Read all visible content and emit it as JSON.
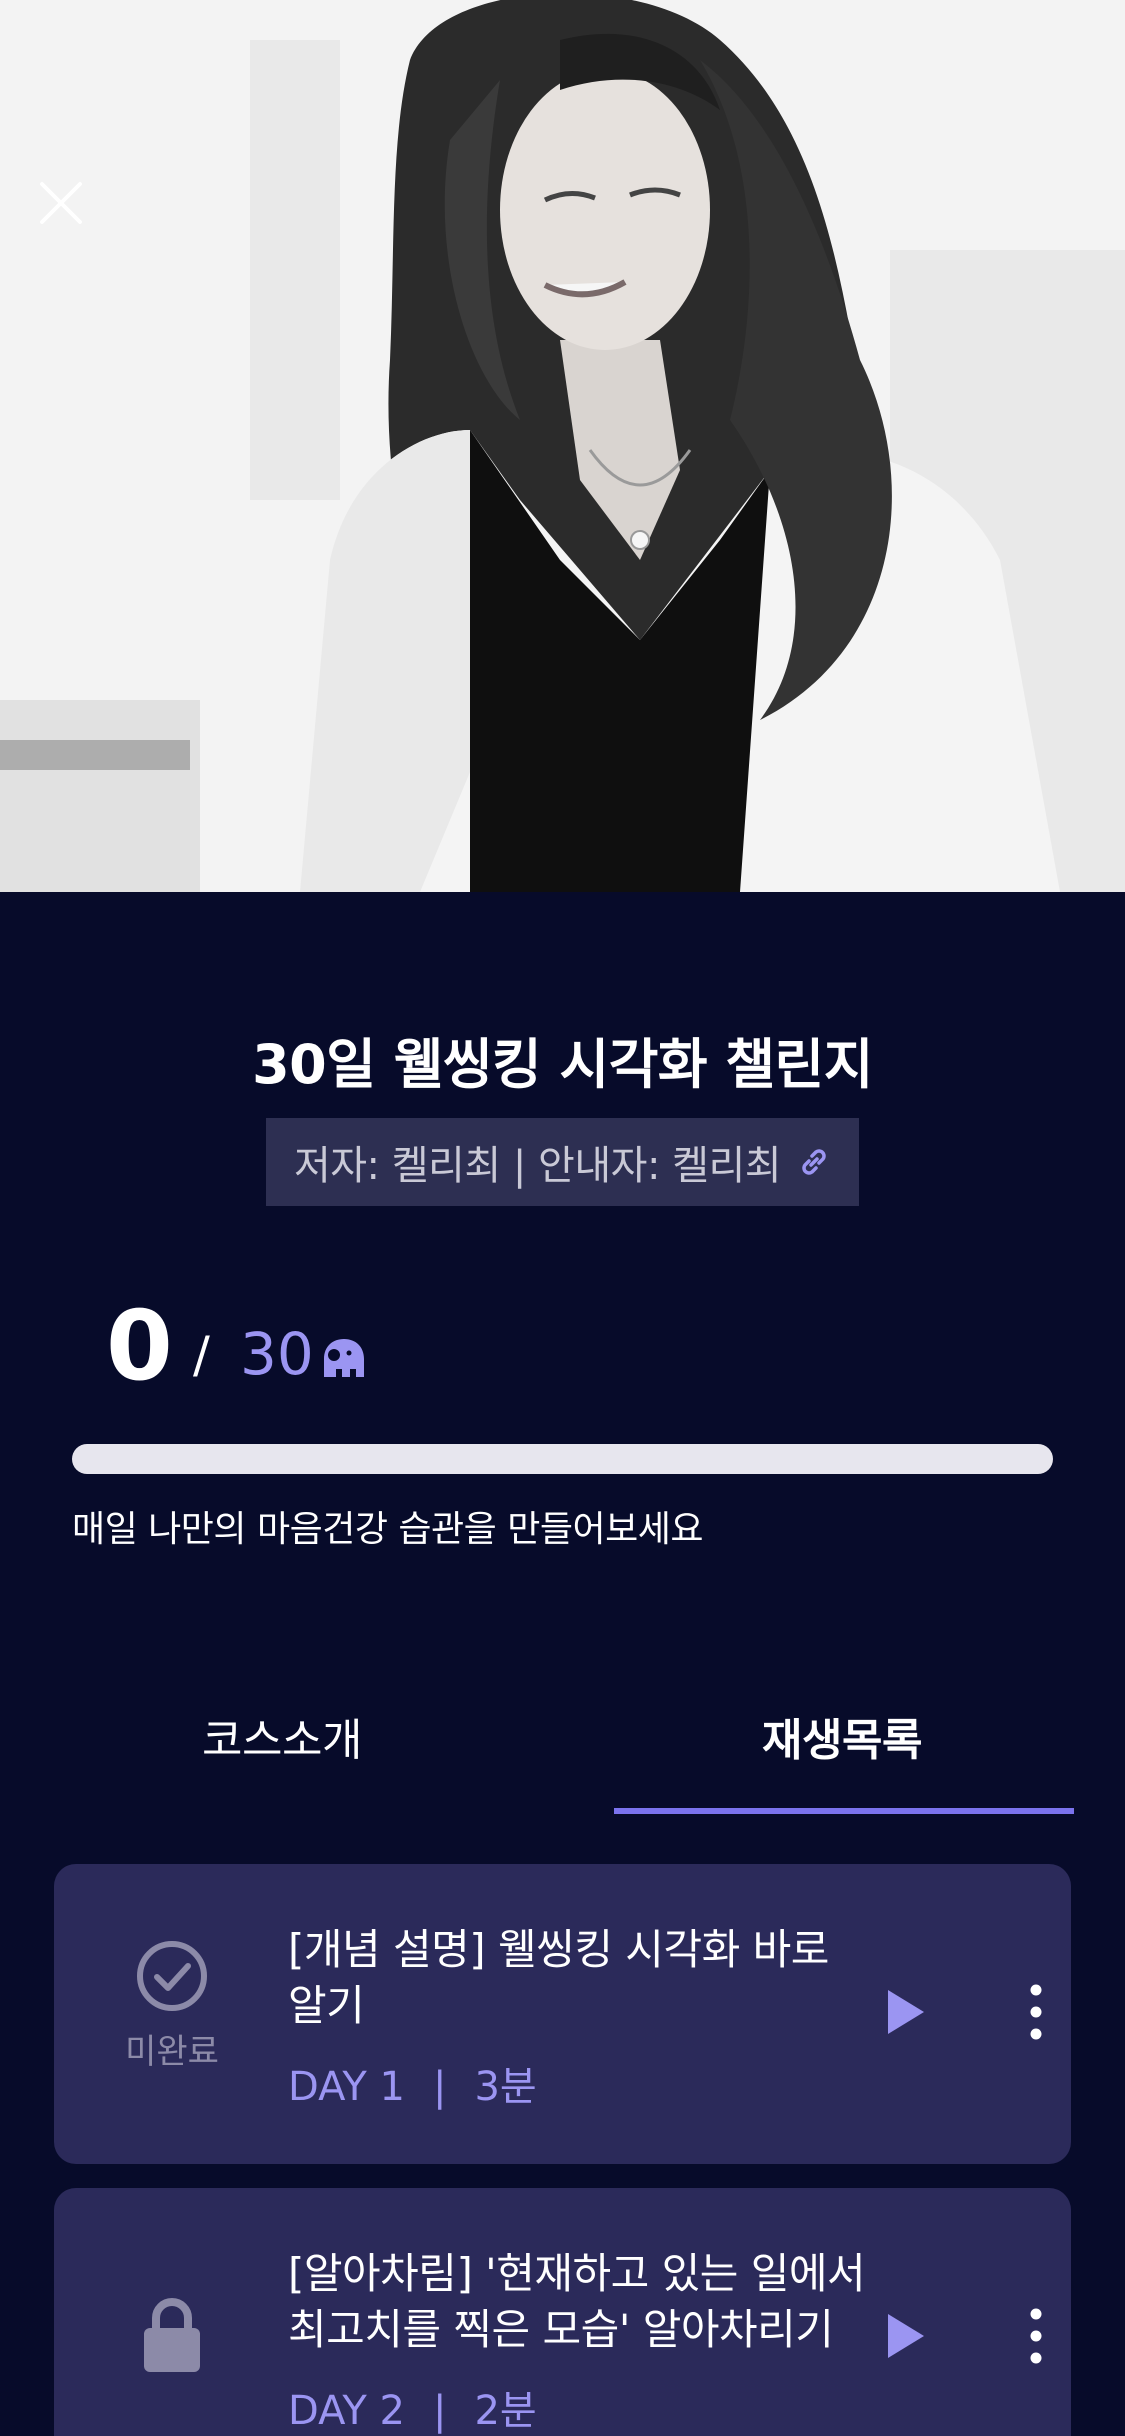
{
  "hero": {
    "image_alt": "course hero photo"
  },
  "course": {
    "title": "30일 웰씽킹 시각화 챌린지",
    "author_line": "저자: 켈리최 | 안내자: 켈리최"
  },
  "progress": {
    "completed": "0",
    "separator": "/",
    "total": "30",
    "fraction": 0,
    "caption": "매일 나만의 마음건강 습관을 만들어보세요"
  },
  "tabs": [
    {
      "label": "코스소개",
      "active": false
    },
    {
      "label": "재생목록",
      "active": true
    }
  ],
  "playlist": [
    {
      "title": "[개념 설명] 웰씽킹 시각화 바로 알기",
      "day": "DAY 1",
      "divider": "|",
      "duration": "3분",
      "status": "미완료",
      "locked": false
    },
    {
      "title": "[알아차림] '현재하고 있는 일에서 최고치를 찍은 모습' 알아차리기",
      "day": "DAY 2",
      "divider": "|",
      "duration": "2분",
      "locked": true
    }
  ],
  "colors": {
    "background": "#070b2a",
    "accent": "#9b95f2",
    "card": "#2b2a5a",
    "chip": "#2d2f52",
    "track": "#e7e6ee"
  },
  "icons": [
    "close-icon",
    "link-icon",
    "elephant-icon",
    "check-circle-icon",
    "lock-icon",
    "play-icon",
    "more-vertical-icon"
  ]
}
